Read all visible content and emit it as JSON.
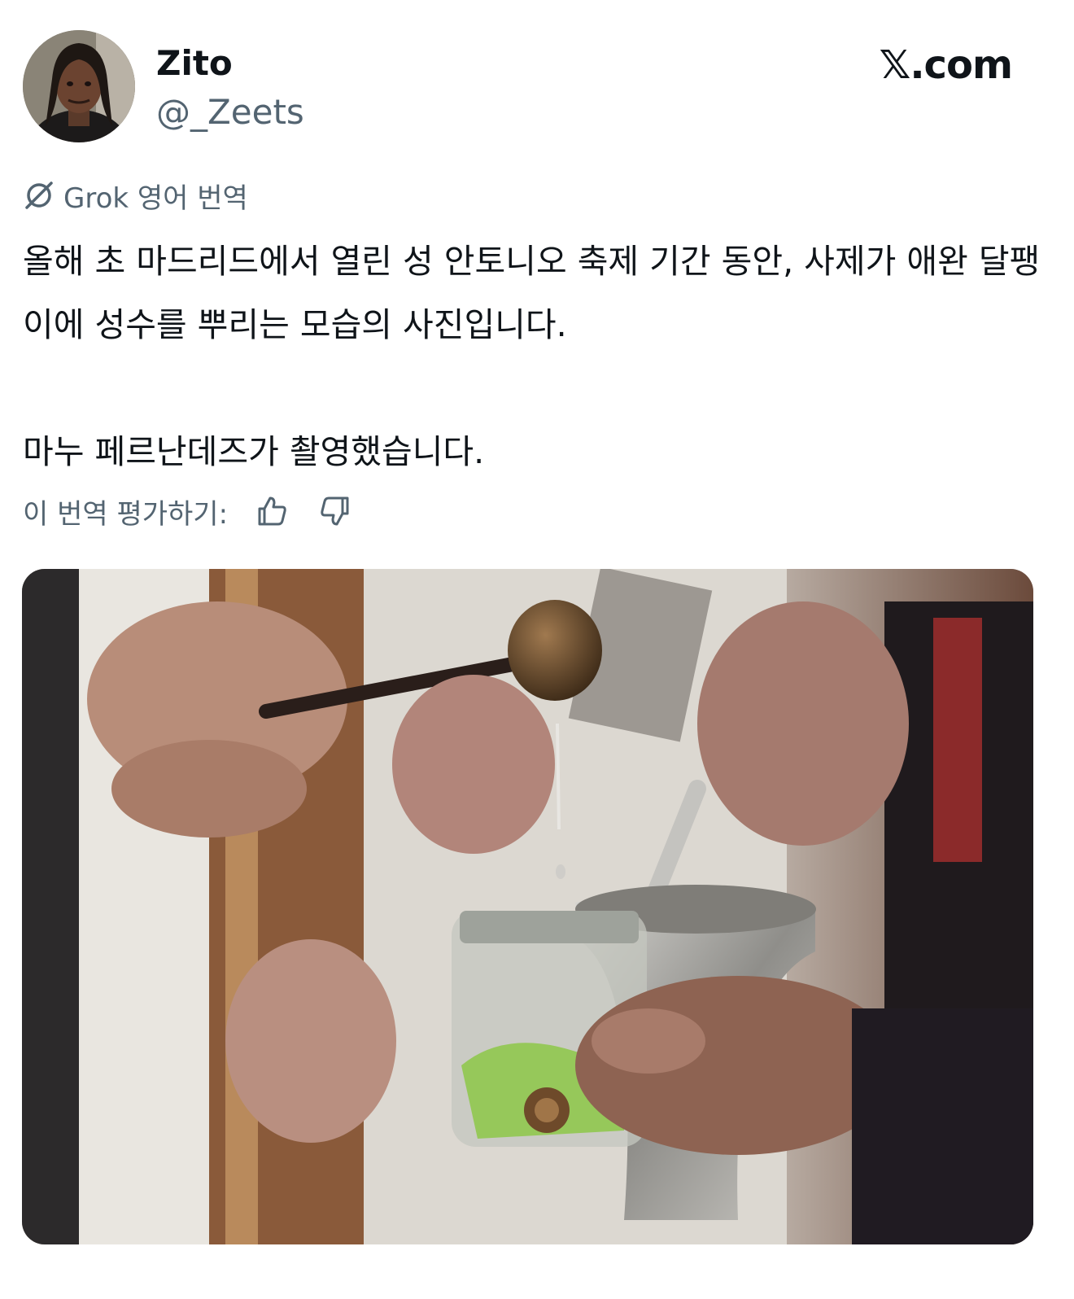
{
  "author": {
    "display_name": "Zito",
    "handle": "@_Zeets"
  },
  "site_logo": "𝕏.com",
  "translation": {
    "label": "Grok 영어 번역",
    "icon": "grok-icon"
  },
  "tweet": {
    "text": "올해 초 마드리드에서 열린 성 안토니오 축제 기간 동안, 사제가 애완 달팽이에 성수를 뿌리는 모습의 사진입니다.\n\n마누 페르난데즈가 촬영했습니다."
  },
  "rating": {
    "label": "이 번역 평가하기:",
    "icons": [
      "thumbs-up-icon",
      "thumbs-down-icon"
    ]
  },
  "colors": {
    "text_primary": "#0f1419",
    "text_secondary": "#536471",
    "background": "#ffffff"
  }
}
